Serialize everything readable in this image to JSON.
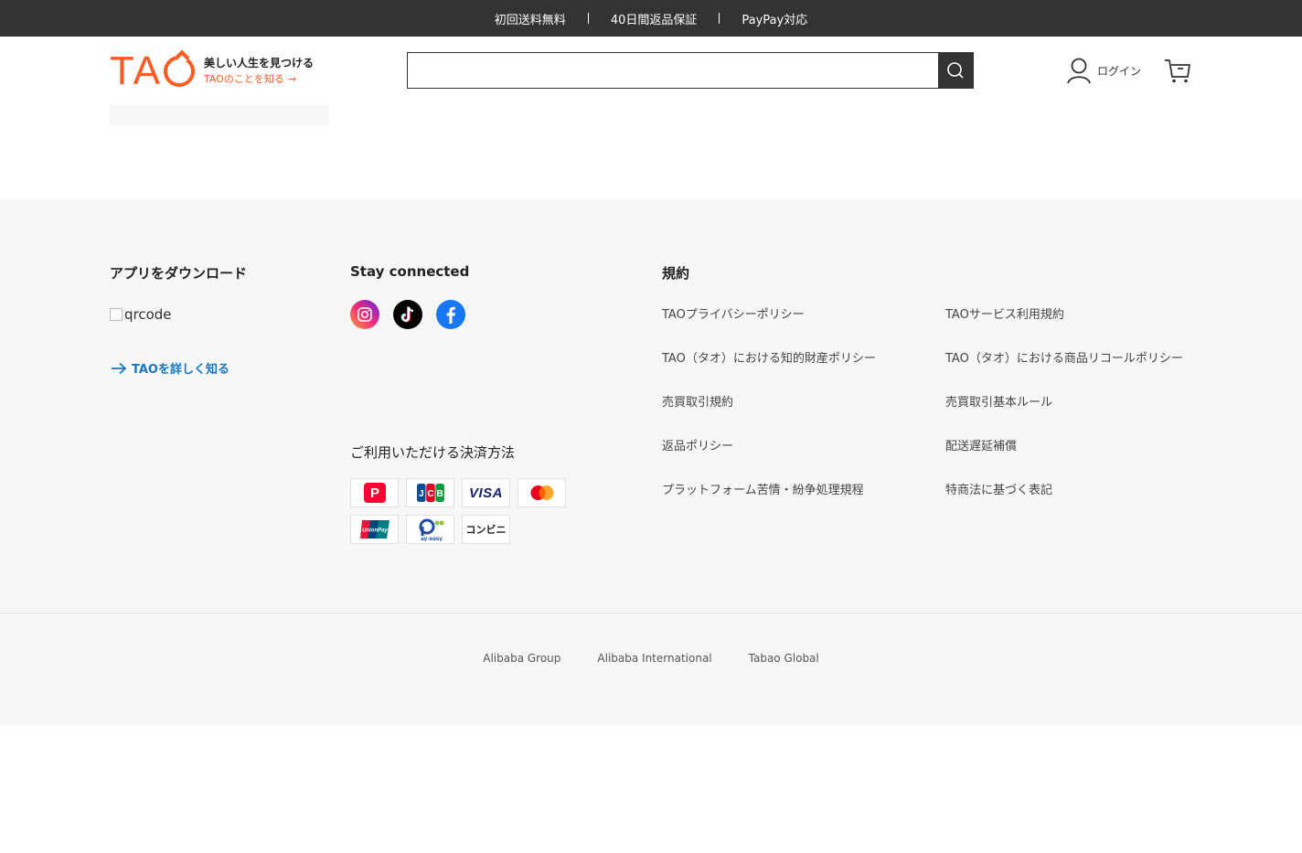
{
  "topbar": {
    "items": [
      "初回送料無料",
      "40日間返品保証",
      "PayPay対応"
    ]
  },
  "header": {
    "logo": "TA",
    "tagline": "美しい人生を見つける",
    "about_link": "TAOのことを知る",
    "search_placeholder": "",
    "login_label": "ログイン"
  },
  "footer": {
    "app": {
      "heading": "アプリをダウンロード",
      "qrcode_alt": "qrcode",
      "learn_more": "TAOを詳しく知る"
    },
    "social": {
      "heading": "Stay connected",
      "icons": [
        "instagram-icon",
        "tiktok-icon",
        "facebook-icon"
      ]
    },
    "payment": {
      "heading": "ご利用いただける決済方法",
      "methods": [
        "PayPay",
        "JCB",
        "VISA",
        "Mastercard",
        "UnionPay",
        "Pay-easy",
        "コンビニ"
      ]
    },
    "terms": {
      "heading": "規約",
      "links": [
        "TAOプライバシーポリシー",
        "TAOサービス利用規約",
        "TAO（タオ）における知的財産ポリシー",
        "TAO（タオ）における商品リコールポリシー",
        "売買取引規約",
        "売買取引基本ルール",
        "返品ポリシー",
        "配送遅延補償",
        "プラットフォーム苦情・紛争処理規程",
        "特商法に基づく表記"
      ]
    },
    "bottom_links": [
      "Alibaba Group",
      "Alibaba International",
      "Tabao Global"
    ]
  },
  "colors": {
    "brand": "#ff5a1f",
    "topbar_bg": "#333333",
    "footer_bg": "#f7f7f5",
    "link_blue": "#1677c8"
  }
}
